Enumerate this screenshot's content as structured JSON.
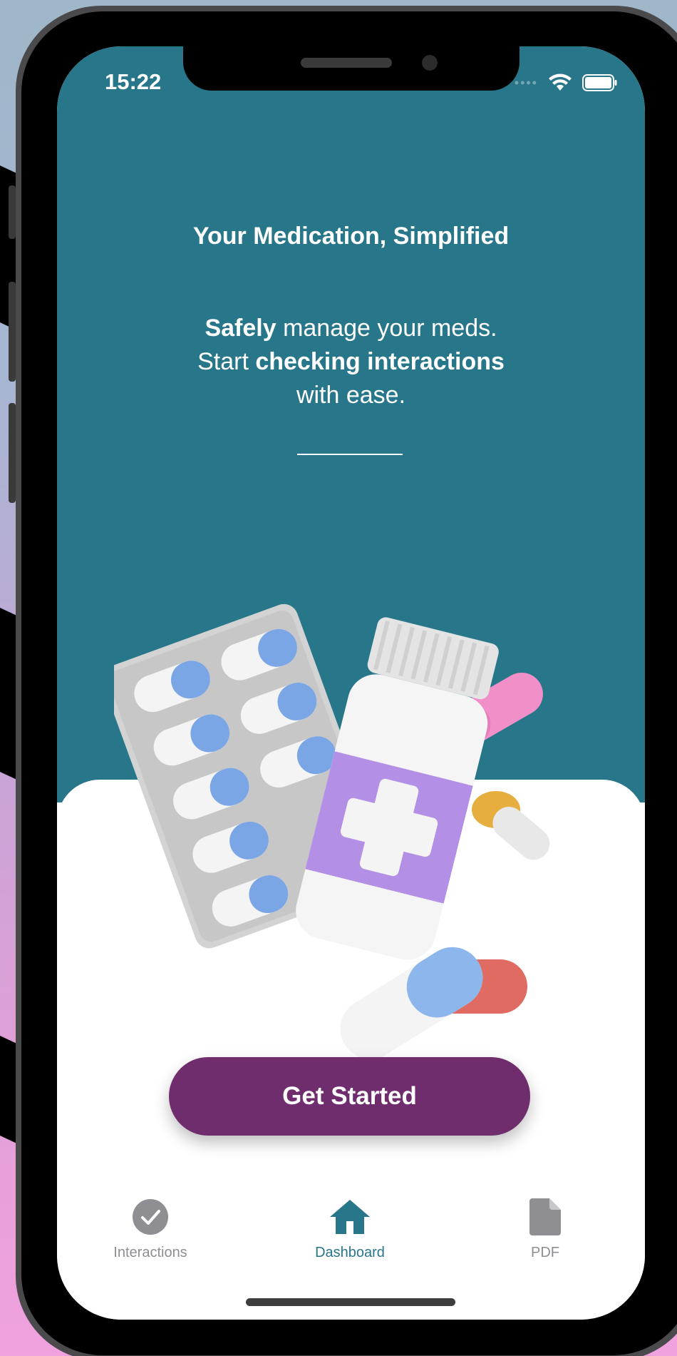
{
  "status_bar": {
    "time": "15:22",
    "icons": [
      "signal-dots-icon",
      "wifi-icon",
      "battery-icon"
    ]
  },
  "hero": {
    "title": "Your Medication, Simplified",
    "tagline_line1_bold": "Safely",
    "tagline_line1_rest": " manage your meds.",
    "tagline_line2_start": "Start ",
    "tagline_line2_bold": "checking interactions",
    "tagline_line3": "with ease."
  },
  "cta": {
    "label": "Get Started"
  },
  "tabbar": {
    "items": [
      {
        "label": "Interactions",
        "icon": "check-circle-icon",
        "active": false
      },
      {
        "label": "Dashboard",
        "icon": "home-icon",
        "active": true
      },
      {
        "label": "PDF",
        "icon": "document-icon",
        "active": false
      }
    ]
  },
  "colors": {
    "header_bg": "#28768a",
    "cta_bg": "#6f2d6d",
    "tab_active": "#28768a",
    "tab_inactive": "#8e8e93"
  }
}
